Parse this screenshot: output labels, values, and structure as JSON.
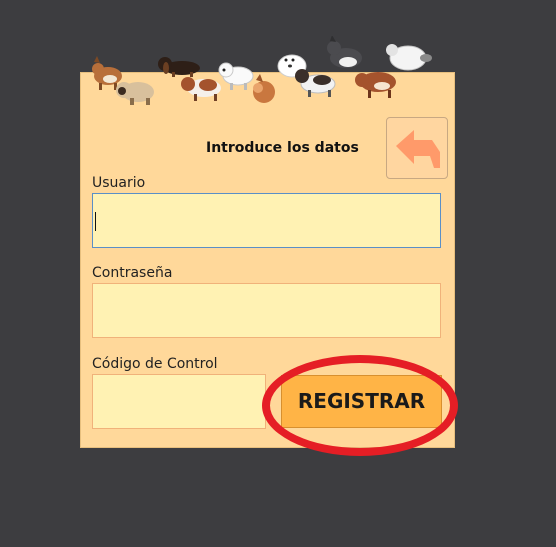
{
  "form": {
    "title": "Introduce los datos",
    "fields": [
      {
        "label": "Usuario",
        "value": "",
        "placeholder": ""
      },
      {
        "label": "Contraseña",
        "value": "",
        "placeholder": ""
      },
      {
        "label": "Código de Control",
        "value": "",
        "placeholder": ""
      }
    ],
    "register_label": "REGISTRAR",
    "back_icon": "back-arrow-icon"
  },
  "decorations": {
    "header_image": "pixel-dogs-banner"
  },
  "colors": {
    "background": "#3d3d40",
    "panel": "#ffd89a",
    "input_fill": "#fff2b3",
    "input_border": "#f0b27a",
    "focus_border": "#5a8fc7",
    "button": "#ffb446",
    "back_arrow": "#ff9a6a",
    "highlight": "#e51e25"
  }
}
